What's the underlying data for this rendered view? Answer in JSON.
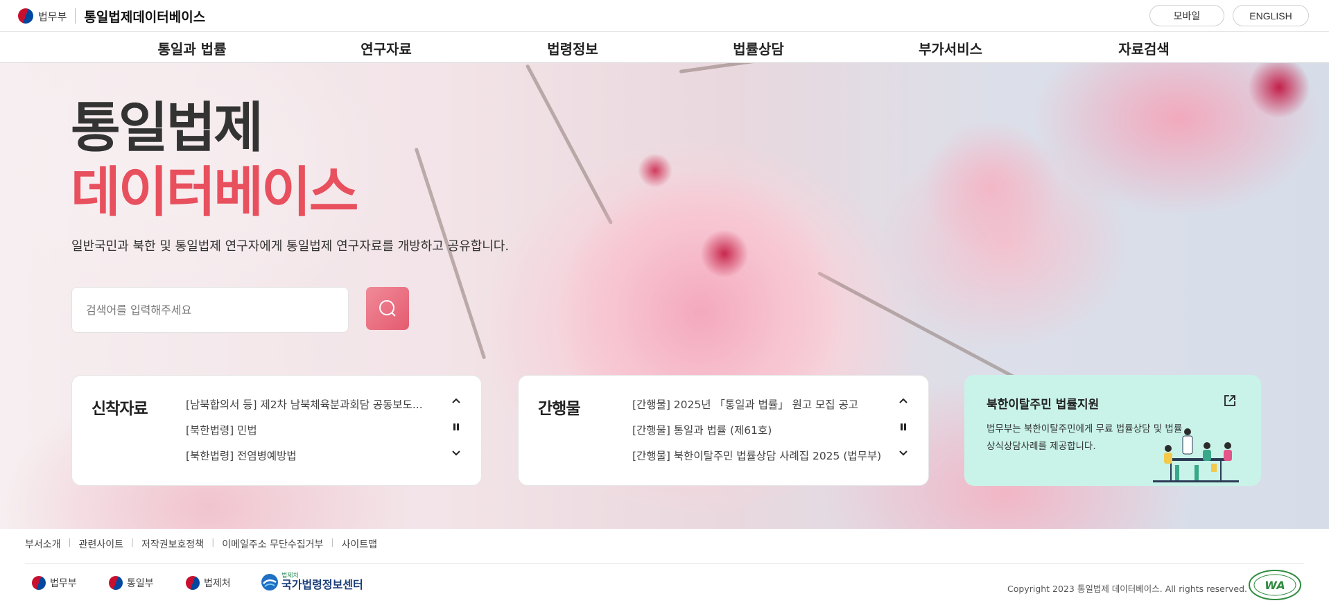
{
  "header": {
    "ministry": "법무부",
    "site_title": "통일법제데이터베이스",
    "mobile_button": "모바일",
    "english_button": "ENGLISH"
  },
  "nav": {
    "items": [
      {
        "label": "통일과 법률"
      },
      {
        "label": "연구자료"
      },
      {
        "label": "법령정보"
      },
      {
        "label": "법률상담"
      },
      {
        "label": "부가서비스"
      },
      {
        "label": "자료검색"
      }
    ]
  },
  "hero": {
    "title_line1": "통일법제",
    "title_line2": "데이터베이스",
    "subtitle": "일반국민과 북한 및 통일법제 연구자에게 통일법제 연구자료를 개방하고 공유합니다.",
    "search_placeholder": "검색어를 입력해주세요",
    "accent_color": "#e8505e"
  },
  "new_materials": {
    "heading": "신착자료",
    "items": [
      "[남북합의서 등] 제2차 남북체육분과회담 공동보도...",
      "[북한법령] 민법",
      "[북한법령] 전염병예방법"
    ]
  },
  "publications": {
    "heading": "간행물",
    "items": [
      "[간행물] 2025년 「통일과 법률」 원고 모집 공고",
      "[간행물] 통일과 법률 (제61호)",
      "[간행물] 북한이탈주민 법률상담 사례집 2025 (법무부)"
    ]
  },
  "support": {
    "title": "북한이탈주민 법률지원",
    "description": "법무부는 북한이탈주민에게 무료 법률상담 및 법률상식상담사례를 제공합니다.",
    "background_color": "#c9f3e9"
  },
  "footer": {
    "links": [
      "부서소개",
      "관련사이트",
      "저작권보호정책",
      "이메일주소 무단수집거부",
      "사이트맵"
    ],
    "logos": [
      "법무부",
      "통일부",
      "법제처"
    ],
    "law_center_small": "법제처",
    "law_center": "국가법령정보센터",
    "copyright": "Copyright 2023 통일법제 데이터베이스. All rights reserved."
  }
}
